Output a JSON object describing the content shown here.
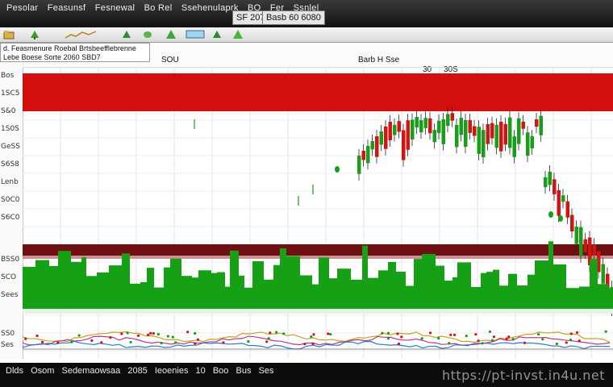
{
  "window": {
    "menu": [
      "Pesolar",
      "Feasunsf",
      "Fesnewal",
      "Bo Rel",
      "Ssehenulaprk",
      "BO",
      "Fer",
      "Ssnlel"
    ],
    "field_left": "SF 207",
    "field_right": "Basb 60 6080"
  },
  "toolbar": {
    "icons": [
      "folder-icon",
      "tree-icon",
      "chart-icon",
      "tree-icon",
      "leaf-icon",
      "tree-icon",
      "monitor-icon",
      "tree-icon",
      "leaf-icon"
    ]
  },
  "header": {
    "info_lines": [
      "d. Feasmenure Roebal  Brtsbeefflebrenne",
      "Lebe Boese Sorte 2060 SBD7"
    ],
    "mid_label": "SOU",
    "right_label_1": "Barb  H Sse",
    "right_label_2": "30",
    "right_label_3": "30S"
  },
  "yaxis": {
    "ticks": [
      "Bos",
      "1SC5",
      "S&0",
      "1S0S",
      "GeSS",
      "S6S8",
      "Lenb",
      "S0C0",
      "S6C0",
      "BSS0",
      "SCO",
      "Sees",
      "SS0",
      "Ses"
    ]
  },
  "chart": {
    "colors": {
      "up": "#1a9e1a",
      "down": "#d01515",
      "band_top": "#d40f0f",
      "band_mid": "#6f0f12",
      "volume": "#16a016"
    }
  },
  "statusbar": {
    "items": [
      "Dlds",
      "Osom",
      "Sedemaowsaa",
      "2085",
      "Ieoenies",
      "10",
      "Boo",
      "Bus",
      "Ses"
    ],
    "watermark": "https://pt-invst.in4u.net"
  }
}
